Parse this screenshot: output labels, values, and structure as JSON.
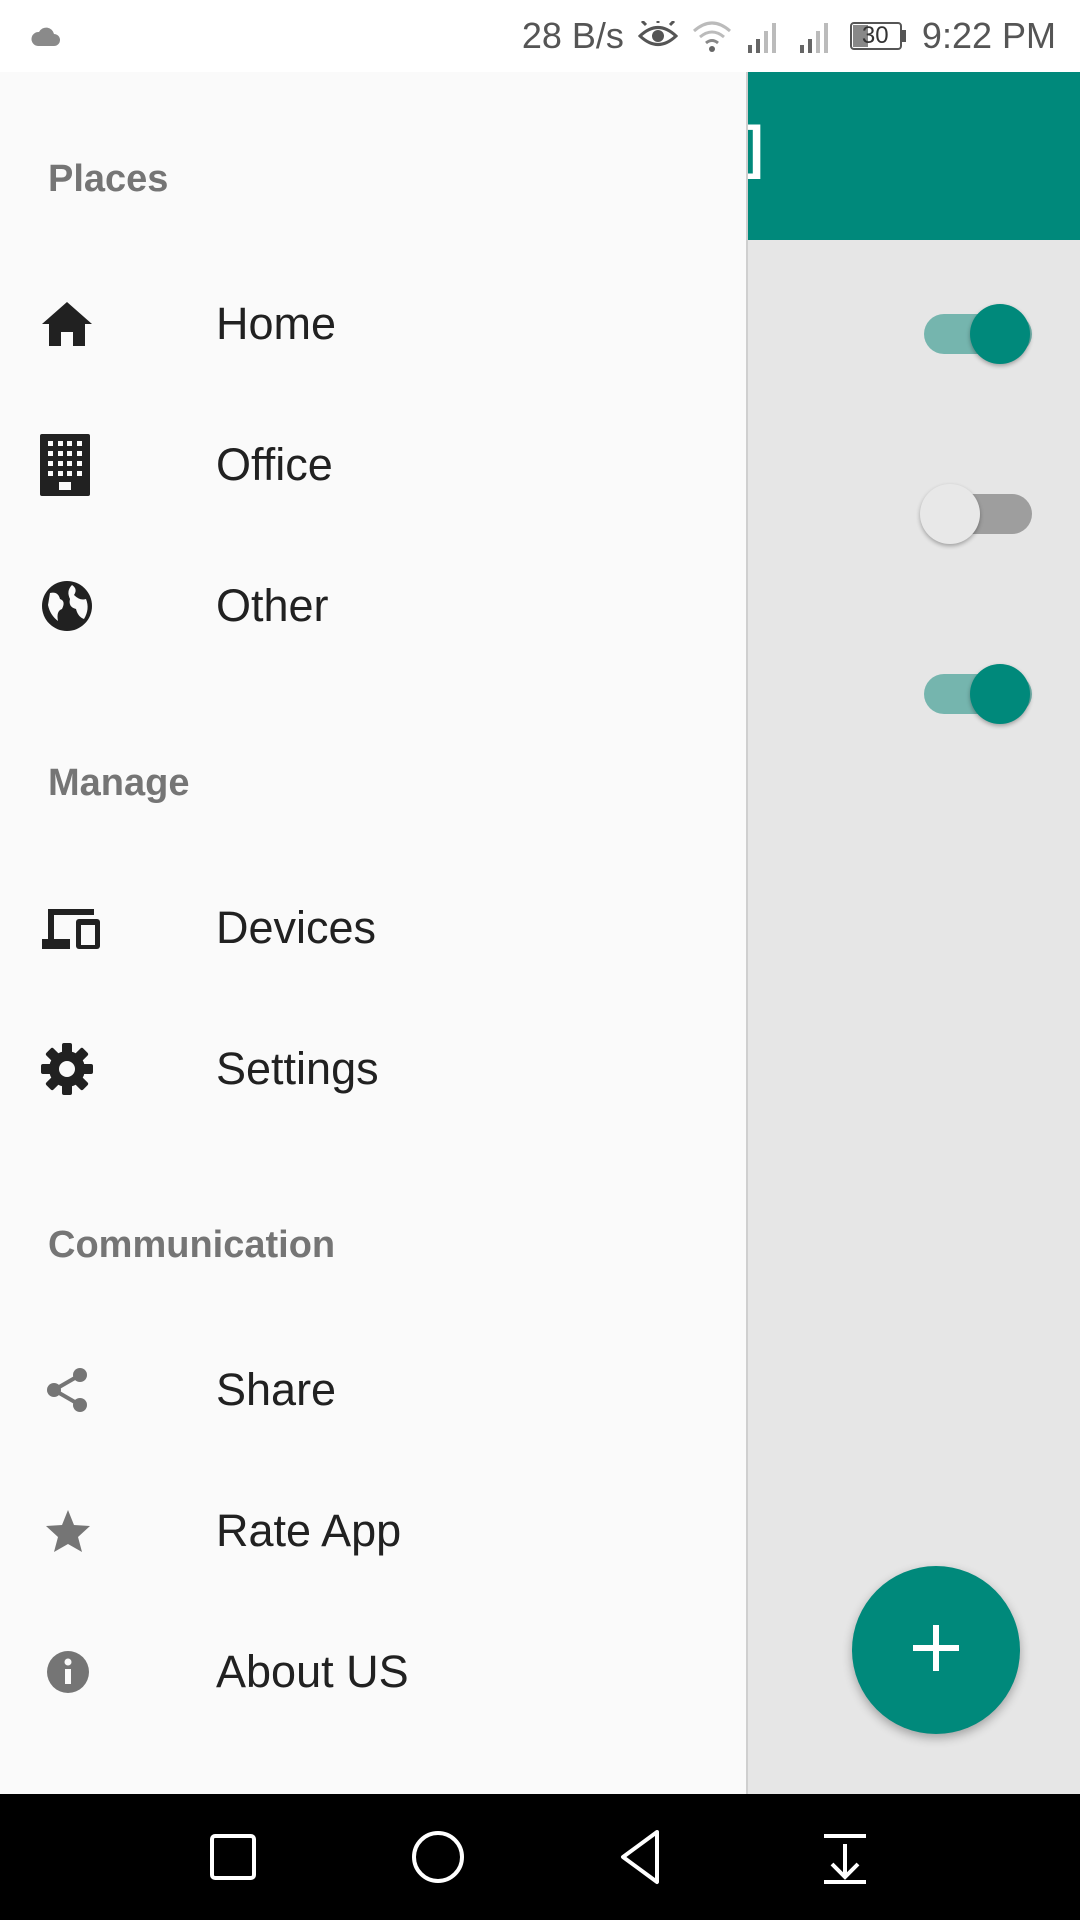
{
  "status_bar": {
    "net_speed": "28 B/s",
    "battery": "30",
    "time": "9:22 PM",
    "icons": [
      "cloud-icon",
      "eye-icon",
      "wifi-icon",
      "signal-icon",
      "signal-icon",
      "battery-icon"
    ]
  },
  "app": {
    "title": "e]",
    "toolbar_color": "#00897b",
    "switches": [
      {
        "state": "on"
      },
      {
        "state": "off"
      },
      {
        "state": "on"
      }
    ],
    "fab_icon": "plus-icon"
  },
  "drawer": {
    "sections": [
      {
        "header": "Places",
        "items": [
          {
            "label": "Home",
            "icon": "home-icon"
          },
          {
            "label": "Office",
            "icon": "office-building-icon"
          },
          {
            "label": "Other",
            "icon": "globe-icon"
          }
        ]
      },
      {
        "header": "Manage",
        "items": [
          {
            "label": "Devices",
            "icon": "devices-icon"
          },
          {
            "label": "Settings",
            "icon": "gear-icon"
          }
        ]
      },
      {
        "header": "Communication",
        "items": [
          {
            "label": "Share",
            "icon": "share-icon"
          },
          {
            "label": "Rate App",
            "icon": "star-icon"
          },
          {
            "label": "About US",
            "icon": "info-icon"
          }
        ]
      }
    ]
  },
  "nav_bar": {
    "buttons": [
      "recents-square-icon",
      "home-circle-icon",
      "back-triangle-icon",
      "notification-pull-icon"
    ]
  }
}
